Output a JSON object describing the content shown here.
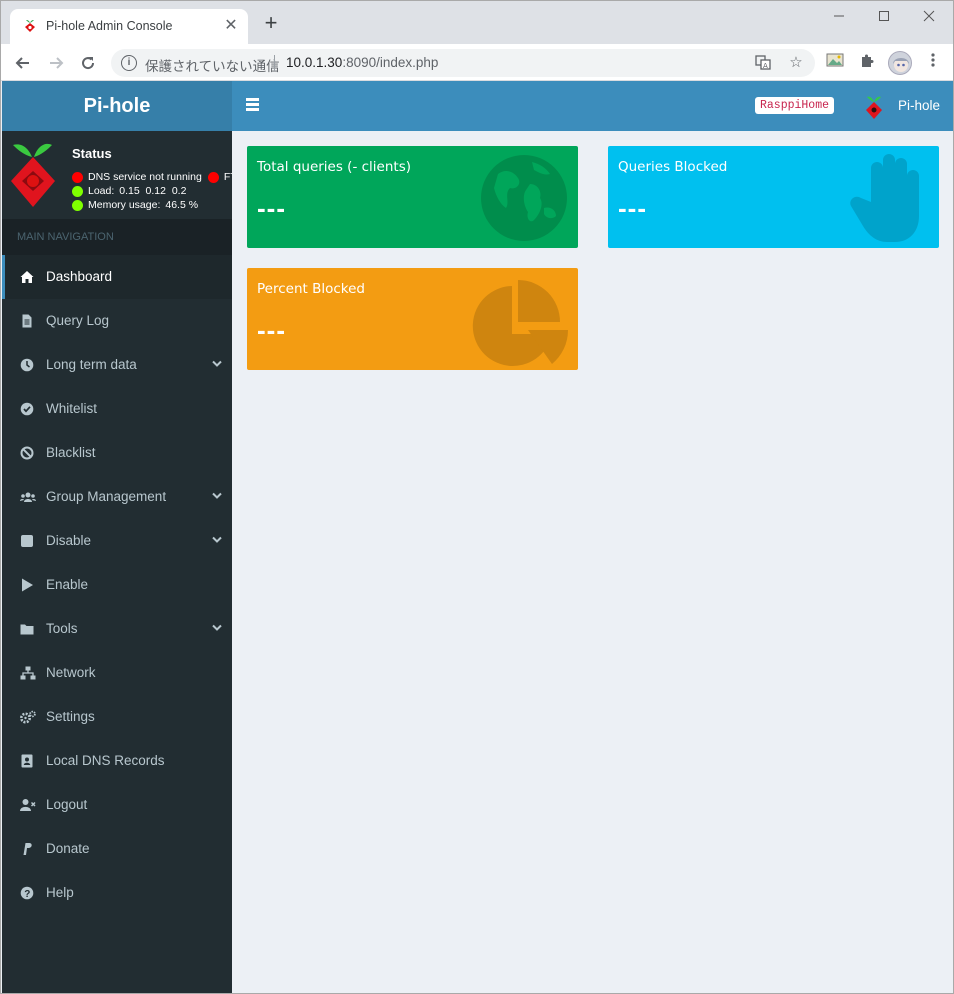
{
  "browser": {
    "tab_title": "Pi-hole Admin Console",
    "tab_close": "✕",
    "new_tab": "+",
    "security_text": "保護されていない通信",
    "url_host": "10.0.1.30",
    "url_rest": ":8090/index.php"
  },
  "header": {
    "logo_text": "Pi-hole",
    "hostname_badge": "RasppiHome",
    "user_label": "Pi-hole"
  },
  "status": {
    "title": "Status",
    "dns_status": "DNS service not running",
    "ftl_label": "FT",
    "load_label": "Load:",
    "load_values": "0.15  0.12  0.2",
    "memory_label": "Memory usage:",
    "memory_value": "46.5 %"
  },
  "sidebar": {
    "section_header": "MAIN NAVIGATION",
    "items": [
      {
        "label": "Dashboard",
        "icon": "home-icon",
        "active": true
      },
      {
        "label": "Query Log",
        "icon": "file-icon"
      },
      {
        "label": "Long term data",
        "icon": "clock-icon",
        "has_submenu": true
      },
      {
        "label": "Whitelist",
        "icon": "check-circle-icon"
      },
      {
        "label": "Blacklist",
        "icon": "ban-icon"
      },
      {
        "label": "Group Management",
        "icon": "users-icon",
        "has_submenu": true
      },
      {
        "label": "Disable",
        "icon": "stop-icon",
        "has_submenu": true
      },
      {
        "label": "Enable",
        "icon": "play-icon"
      },
      {
        "label": "Tools",
        "icon": "folder-icon",
        "has_submenu": true
      },
      {
        "label": "Network",
        "icon": "network-icon"
      },
      {
        "label": "Settings",
        "icon": "gears-icon"
      },
      {
        "label": "Local DNS Records",
        "icon": "address-book-icon"
      },
      {
        "label": "Logout",
        "icon": "user-times-icon"
      },
      {
        "label": "Donate",
        "icon": "paypal-icon"
      },
      {
        "label": "Help",
        "icon": "question-circle-icon"
      }
    ]
  },
  "dashboard": {
    "boxes": [
      {
        "title": "Total queries (- clients)",
        "value": "---",
        "color": "#00a65a",
        "icon": "globe-icon"
      },
      {
        "title": "Queries Blocked",
        "value": "---",
        "color": "#00c0ef",
        "icon": "hand-icon"
      },
      {
        "title": "Percent Blocked",
        "value": "---",
        "color": "#f39c12",
        "icon": "pie-chart-icon"
      }
    ]
  },
  "colors": {
    "header_blue": "#3c8dbc",
    "logo_blue": "#367fa9",
    "sidebar_dark": "#222d32",
    "content_bg": "#ecf0f5"
  }
}
